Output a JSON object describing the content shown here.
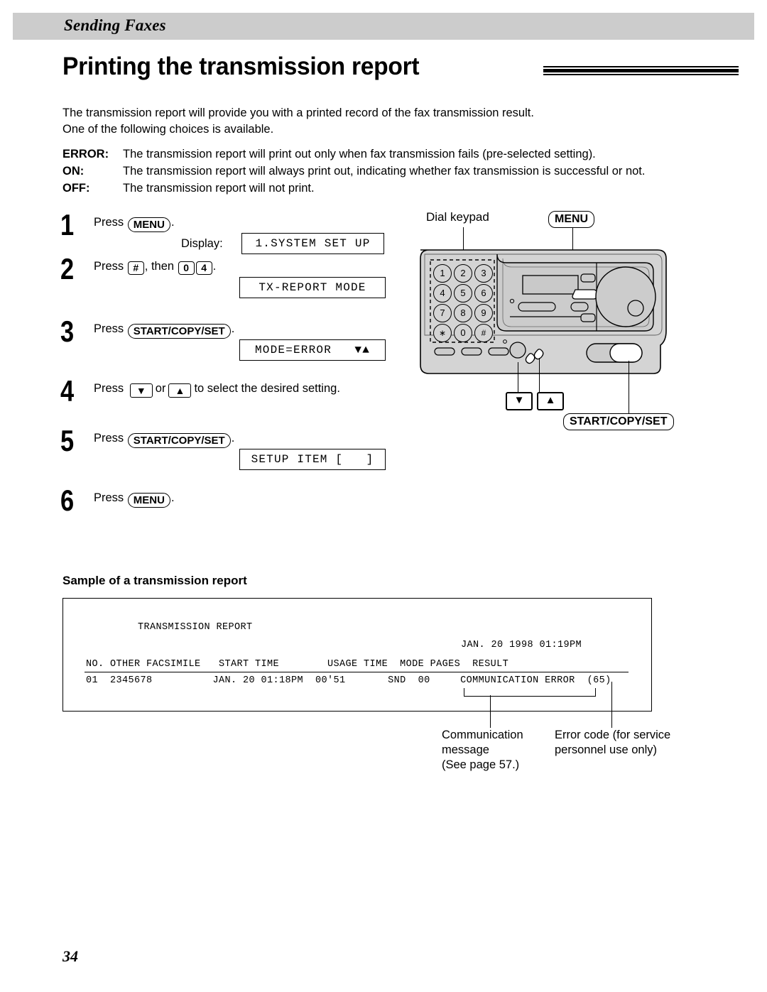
{
  "running_head": {
    "title": "Sending Faxes"
  },
  "heading": {
    "title": "Printing the transmission report"
  },
  "intro": {
    "line1": "The transmission report will provide you with a printed record of the fax transmission result.",
    "line2": "One of the following choices is available."
  },
  "choices": [
    {
      "label": "ERROR:",
      "text": "The transmission report will print out only when fax transmission fails (pre-selected setting)."
    },
    {
      "label": "ON:",
      "text": "The transmission report will always print out, indicating whether fax transmission is successful or not."
    },
    {
      "label": "OFF:",
      "text": "The transmission report will not print."
    }
  ],
  "steps": {
    "s1": {
      "num": "1",
      "press": "Press",
      "key": "MENU",
      "period": ".",
      "display_label": "Display:",
      "lcd": "1.SYSTEM SET UP"
    },
    "s2": {
      "num": "2",
      "press": "Press",
      "key_hash": "#",
      "then": ", then",
      "key_0": "0",
      "key_4": "4",
      "period": ".",
      "lcd": "TX-REPORT MODE"
    },
    "s3": {
      "num": "3",
      "press": "Press",
      "key": "START/COPY/SET",
      "period": ".",
      "lcd": "MODE=ERROR   ▼▲"
    },
    "s4": {
      "num": "4",
      "press": "Press",
      "arrow_down": "▼",
      "or": "or",
      "arrow_up": "▲",
      "tail": "to select the desired setting."
    },
    "s5": {
      "num": "5",
      "press": "Press",
      "key": "START/COPY/SET",
      "period": ".",
      "lcd": "SETUP ITEM [   ]"
    },
    "s6": {
      "num": "6",
      "press": "Press",
      "key": "MENU",
      "period": "."
    }
  },
  "fax_diagram": {
    "dial_keypad_label": "Dial keypad",
    "menu_label": "MENU",
    "start_copy_set_label": "START/COPY/SET",
    "arrow_down": "▼",
    "arrow_up": "▲",
    "keypad_keys": [
      "1",
      "2",
      "3",
      "4",
      "5",
      "6",
      "7",
      "8",
      "9",
      "∗",
      "0",
      "#"
    ]
  },
  "sample": {
    "label": "Sample of a transmission report",
    "report_title": "TRANSMISSION REPORT",
    "report_date": "JAN. 20 1998 01:19PM",
    "header_row": "NO. OTHER FACSIMILE   START TIME        USAGE TIME  MODE PAGES  RESULT",
    "data_row": "01  2345678          JAN. 20 01:18PM  00'51       SND  00     COMMUNICATION ERROR  (65)",
    "columns": [
      "NO.",
      "OTHER FACSIMILE",
      "START TIME",
      "USAGE TIME",
      "MODE",
      "PAGES",
      "RESULT"
    ],
    "row_values": {
      "no": "01",
      "other_facsimile": "2345678",
      "start_time": "JAN. 20 01:18PM",
      "usage_time": "00'51",
      "mode": "SND",
      "pages": "00",
      "result": "COMMUNICATION ERROR",
      "error_code": "(65)"
    }
  },
  "callouts": {
    "communication_message": "Communication\nmessage\n(See page 57.)",
    "comm_l1": "Communication",
    "comm_l2": "message",
    "comm_l3": "(See page 57.)",
    "error_code_l1": "Error code (for service",
    "error_code_l2": "personnel use only)"
  },
  "footer": {
    "page_number": "34"
  },
  "colors": {
    "runhead_bg": "#cccccc",
    "machine_body": "#d4d4d4",
    "machine_panel": "#c9c9c9",
    "ink": "#000000"
  }
}
